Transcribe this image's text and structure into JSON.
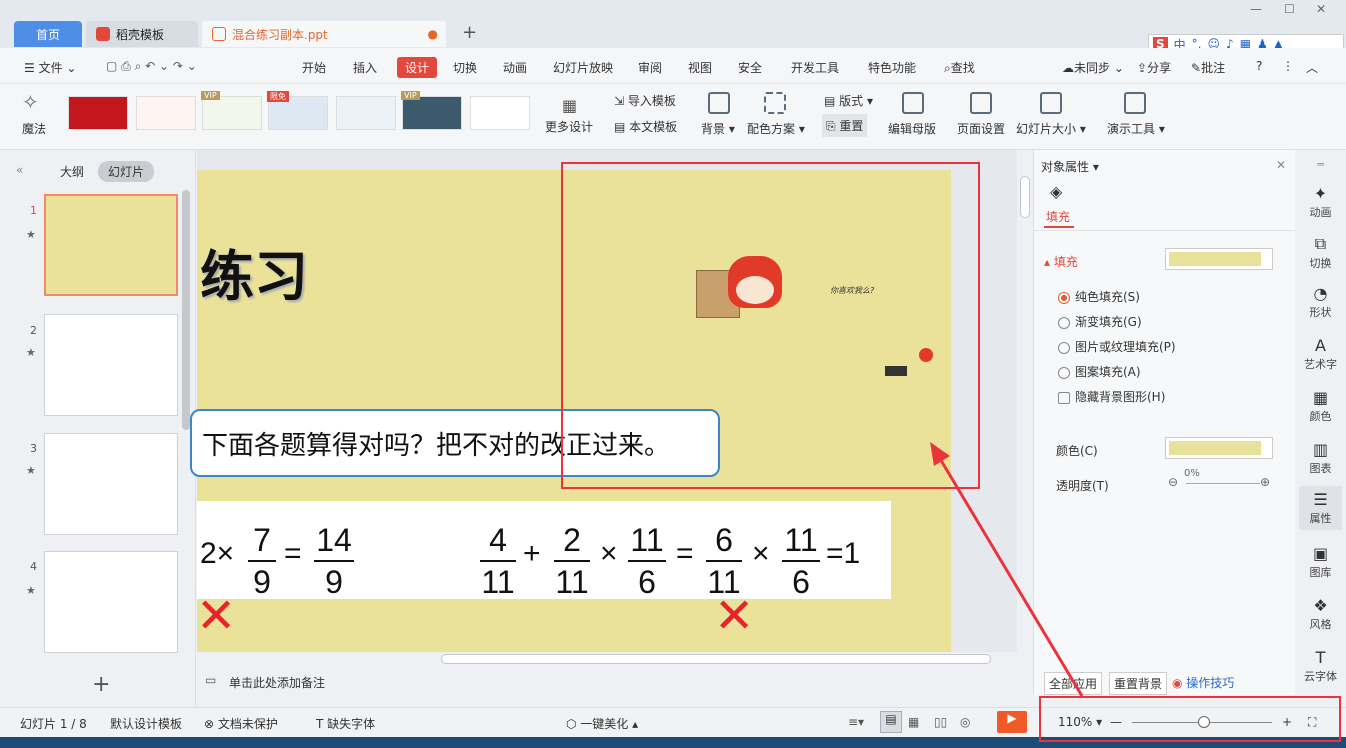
{
  "tabs": {
    "home": "首页",
    "template": "稻壳模板",
    "doc": "混合练习副本.ppt"
  },
  "menu": {
    "file": "文件",
    "items": [
      "开始",
      "插入",
      "设计",
      "切换",
      "动画",
      "幻灯片放映",
      "审阅",
      "视图",
      "安全",
      "开发工具",
      "特色功能"
    ],
    "search": "查找",
    "unsync": "未同步",
    "share": "分享",
    "comment": "批注"
  },
  "ribbon": {
    "magic": "魔法",
    "more_design": "更多设计",
    "import_tpl": "导入模板",
    "text_tpl": "本文模板",
    "background": "背景",
    "color_scheme": "配色方案",
    "layout": "版式",
    "reset": "重置",
    "edit_master": "编辑母版",
    "page_setup": "页面设置",
    "slide_size": "幻灯片大小",
    "present_tools": "演示工具",
    "vip": "VIP",
    "free": "限免"
  },
  "left": {
    "outline": "大纲",
    "slides": "幻灯片",
    "numbers": [
      "1",
      "2",
      "3",
      "4"
    ],
    "star": "★"
  },
  "slide": {
    "title": "练习",
    "question": "下面各题算得对吗？把不对的改正过来。",
    "caption": "你喜欢我么?"
  },
  "math": {
    "eq1": {
      "lead": "2×",
      "n1": "7",
      "d1": "9",
      "eq": "=",
      "n2": "14",
      "d2": "9"
    },
    "eq2": {
      "n1": "4",
      "d1": "11",
      "plus": "+",
      "n2": "2",
      "d2": "11",
      "times": "×",
      "n3": "11",
      "d3": "6",
      "eq": "=",
      "n4": "6",
      "d4": "11",
      "times2": "×",
      "n5": "11",
      "d5": "6",
      "res": "=1"
    },
    "wrong": "✕"
  },
  "props": {
    "header": "对象属性",
    "fill_tab": "填充",
    "fill_section": "填充",
    "solid": "纯色填充(S)",
    "gradient": "渐变填充(G)",
    "picture": "图片或纹理填充(P)",
    "pattern": "图案填充(A)",
    "hide_bg": "隐藏背景图形(H)",
    "color": "颜色(C)",
    "transparency": "透明度(T)",
    "transparency_value": "0%",
    "apply_all": "全部应用",
    "reset_bg": "重置背景",
    "tips": "操作技巧"
  },
  "sidebar": [
    "动画",
    "切换",
    "形状",
    "艺术字",
    "颜色",
    "图表",
    "属性",
    "图库",
    "风格",
    "云字体"
  ],
  "notes": {
    "placeholder": "单击此处添加备注"
  },
  "status": {
    "slide_no": "幻灯片 1 / 8",
    "design_tpl": "默认设计模板",
    "unprotected": "文档未保护",
    "missing_font": "缺失字体",
    "beautify": "一键美化",
    "zoom": "110%"
  },
  "colors": {
    "accent": "#e2493a",
    "slide_bg": "#ebe29a",
    "highlight_box": "#e8343c",
    "selected_tab": "#4e8ee8"
  }
}
